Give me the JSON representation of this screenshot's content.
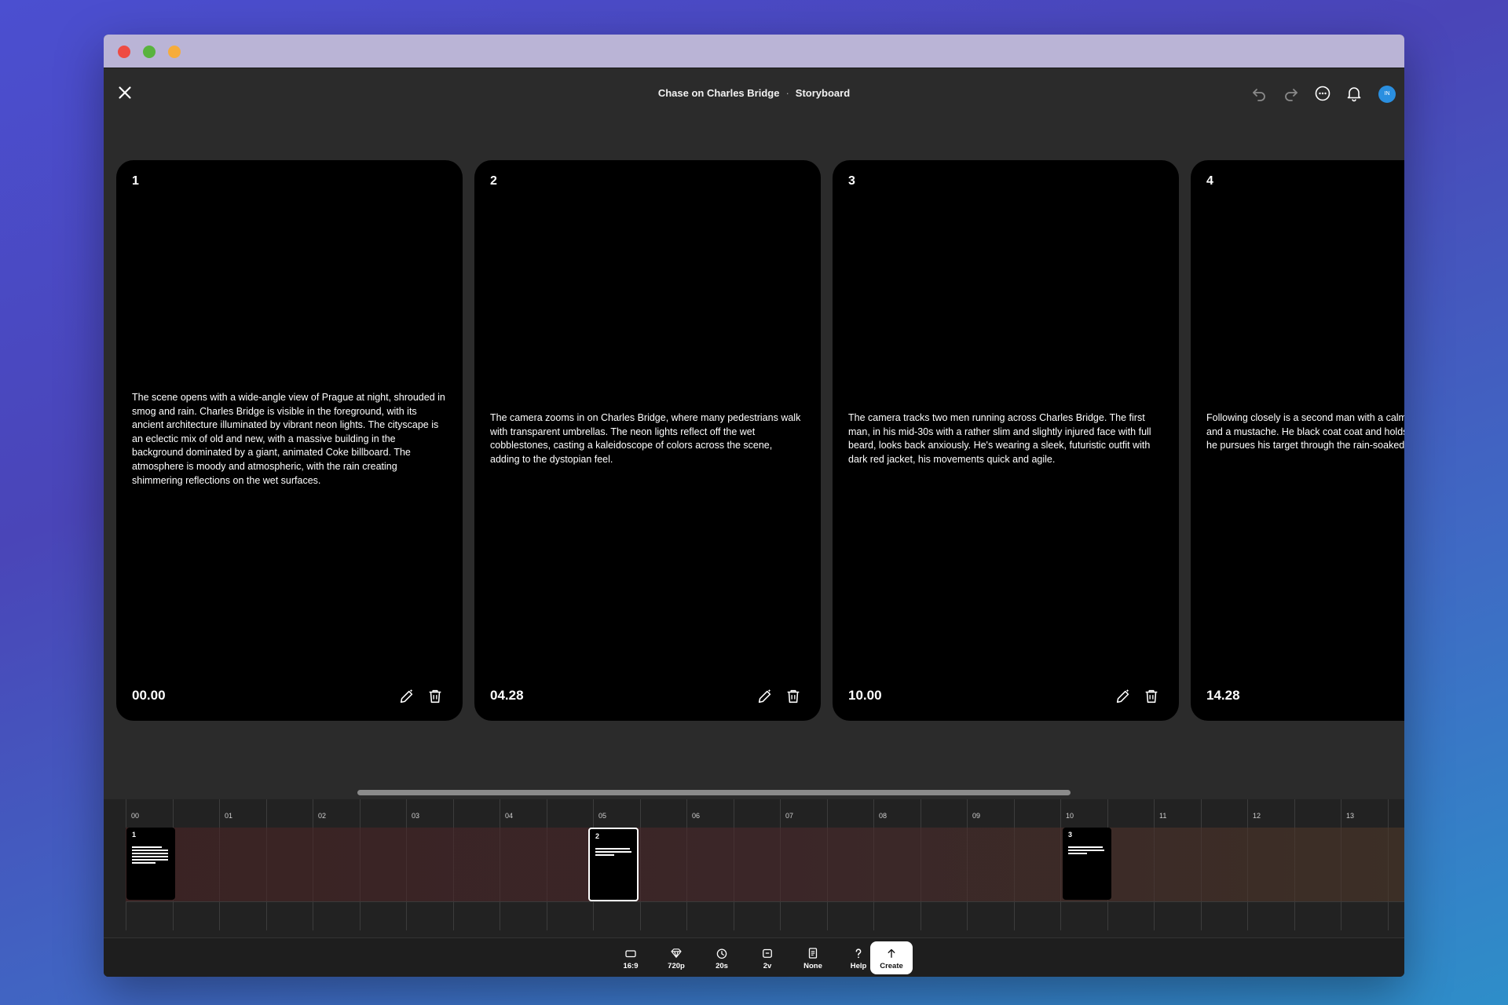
{
  "window": {
    "title": "Chase on Charles Bridge",
    "mode": "Storyboard"
  },
  "header": {
    "avatar_initials": "IN"
  },
  "cards": [
    {
      "number": "1",
      "time": "00.00",
      "description": "The scene opens with a wide-angle view of Prague at night, shrouded in smog and rain. Charles Bridge is visible in the foreground, with its ancient architecture illuminated by vibrant neon lights. The cityscape is an eclectic mix of old and new, with a massive building in the background dominated by a giant, animated Coke billboard. The atmosphere is moody and atmospheric, with the rain creating shimmering reflections on the wet surfaces."
    },
    {
      "number": "2",
      "time": "04.28",
      "description": "The camera zooms in on Charles Bridge, where many pedestrians walk with transparent umbrellas. The neon lights reflect off the wet cobblestones, casting a kaleidoscope of colors across the scene, adding to the dystopian feel."
    },
    {
      "number": "3",
      "time": "10.00",
      "description": "The camera tracks two men running across Charles Bridge. The first man, in his mid-30s with a rather slim and slightly injured face with full beard, looks back anxiously. He's wearing a sleek, futuristic outfit with dark red jacket, his movements quick and agile."
    },
    {
      "number": "4",
      "time": "14.28",
      "description": "Following closely is a second man with a calm demeanor, angular face and a mustache. He black coat coat and holds a gun with precision as he pursues his target through the rain-soaked"
    }
  ],
  "timeline": {
    "ticks": [
      "00",
      "01",
      "02",
      "03",
      "04",
      "05",
      "06",
      "07",
      "08",
      "09",
      "10",
      "11",
      "12",
      "13"
    ],
    "clips": [
      {
        "number": "1",
        "selected": false
      },
      {
        "number": "2",
        "selected": true
      },
      {
        "number": "3",
        "selected": false
      }
    ]
  },
  "toolbar": {
    "aspect": "16:9",
    "quality": "720p",
    "duration": "20s",
    "variants": "2v",
    "style": "None",
    "help": "Help",
    "create": "Create"
  }
}
